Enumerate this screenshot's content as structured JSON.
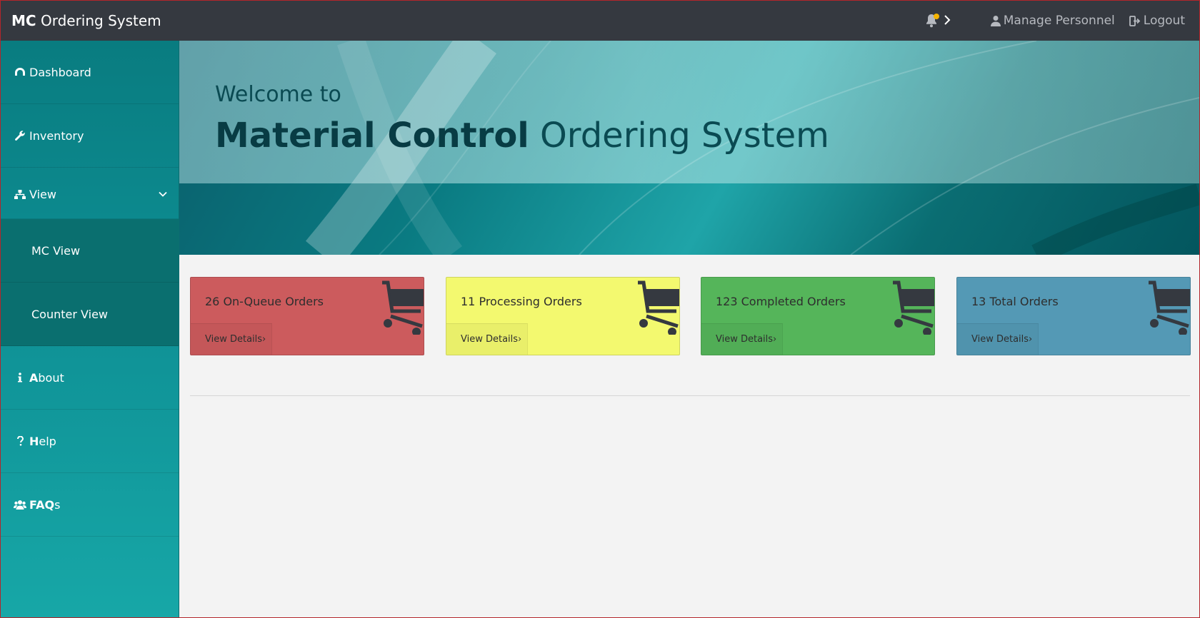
{
  "topbar": {
    "brand_bold": "MC",
    "brand_rest": " Ordering System",
    "manage_personnel": "Manage Personnel",
    "logout": "Logout",
    "notification_dot_color": "#f5b400"
  },
  "sidebar": {
    "items": [
      {
        "label": "Dashboard",
        "icon": "dashboard-icon"
      },
      {
        "label": "Inventory",
        "icon": "wrench-icon"
      },
      {
        "label": "View",
        "icon": "sitemap-icon"
      },
      {
        "label": "MC View"
      },
      {
        "label": "Counter View"
      },
      {
        "label_bold": "A",
        "label_rest": "bout",
        "icon": "info-icon"
      },
      {
        "label_bold": "H",
        "label_rest": "elp",
        "icon": "question-icon"
      },
      {
        "label_bold": "FAQ",
        "label_rest": "s",
        "icon": "users-icon"
      }
    ]
  },
  "banner": {
    "welcome": "Welcome to",
    "title_bold": "Material Control",
    "title_rest": " Ordering System"
  },
  "cards": [
    {
      "label": "26 On-Queue Orders",
      "details": "View Details›",
      "color": "#cc5b5d"
    },
    {
      "label": "11 Processing Orders",
      "details": "View Details›",
      "color": "#f3f96f"
    },
    {
      "label": "123 Completed Orders",
      "details": "View Details›",
      "color": "#55b55a"
    },
    {
      "label": "13 Total Orders",
      "details": "View Details›",
      "color": "#5499b5"
    }
  ]
}
